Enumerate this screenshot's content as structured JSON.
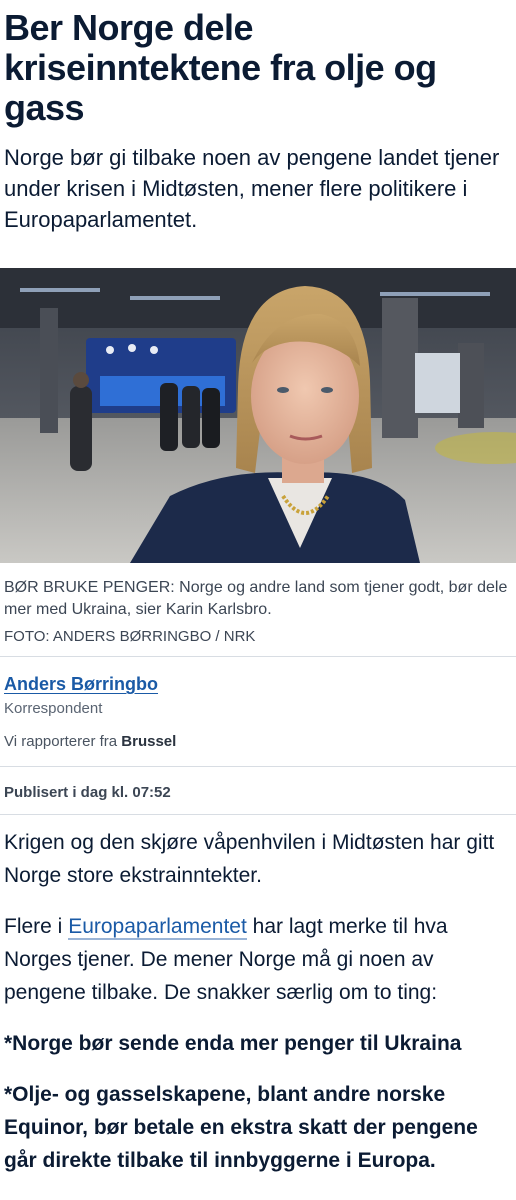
{
  "article": {
    "headline": "Ber Norge dele kriseinntektene fra olje og gass",
    "lead": "Norge bør gi tilbake noen av pengene landet tjener under krisen i Midtøsten, mener flere politikere i Europaparlamentet."
  },
  "photo": {
    "caption": "BØR BRUKE PENGER: Norge og andre land som tjener godt, bør dele mer med Ukraina, sier Karin Karlsbro.",
    "credit": "FOTO: ANDERS BØRRINGBO / NRK"
  },
  "author": {
    "name": "Anders Børringbo",
    "role": "Korrespondent",
    "reporting_prefix": "Vi rapporterer fra",
    "reporting_location": "Brussel"
  },
  "published": "Publisert i dag kl. 07:52",
  "body": {
    "p1": "Krigen og den skjøre våpenhvilen i Midtøsten har gitt Norge store ekstrainntekter.",
    "p2_before": "Flere i ",
    "p2_link": "Europaparlamentet",
    "p2_after": " har lagt merke til hva Norges tjener. De mener Norge må gi noen av pengene tilbake. De snakker særlig om to ting:",
    "point1": "*Norge bør sende enda mer penger til Ukraina",
    "point2": "*Olje- og gasselskapene, blant andre norske Equinor, bør betale en ekstra skatt der pengene går direkte tilbake til innbyggerne i Europa."
  },
  "colors": {
    "text": "#0b1b33",
    "link": "#1a5aa6",
    "muted": "#5a6472"
  }
}
